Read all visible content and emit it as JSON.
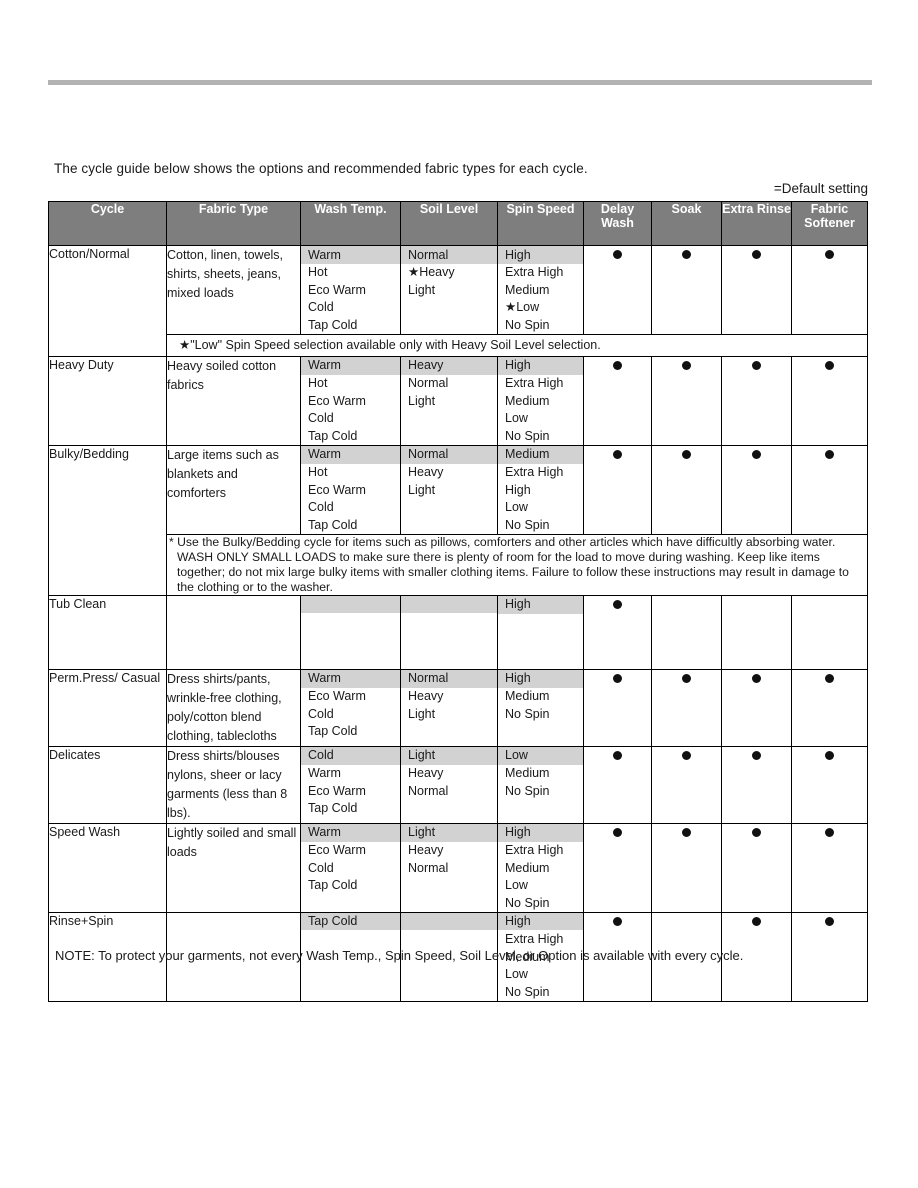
{
  "intro": {
    "text": "The cycle guide below shows the options and recommended fabric types for each cycle.",
    "default_legend": "=Default setting"
  },
  "table": {
    "headers": [
      "Cycle",
      "Fabric Type",
      "Wash Temp.",
      "Soil Level",
      "Spin Speed",
      "Delay Wash",
      "Soak",
      "Extra Rinse",
      "Fabric Softener"
    ],
    "rows": [
      {
        "cycle": "Cotton/Normal",
        "fabric": "Cotton, linen, towels, shirts, sheets, jeans, mixed loads",
        "wash_temp": [
          "Warm",
          "Hot",
          "Eco Warm",
          "Cold",
          "Tap Cold"
        ],
        "wash_temp_default": 0,
        "soil_level": [
          "Normal",
          "★Heavy",
          "Light"
        ],
        "soil_level_default": 0,
        "spin_speed": [
          "High",
          "Extra High",
          "Medium",
          "★Low",
          "No Spin"
        ],
        "spin_speed_default": 0,
        "delay_wash": true,
        "soak": true,
        "extra_rinse": true,
        "fabric_softener": true,
        "note": "★\"Low\" Spin Speed selection available only with  Heavy  Soil Level selection."
      },
      {
        "cycle": "Heavy Duty",
        "fabric": "Heavy soiled cotton fabrics",
        "wash_temp": [
          "Warm",
          "Hot",
          "Eco Warm",
          "Cold",
          "Tap Cold"
        ],
        "wash_temp_default": 0,
        "soil_level": [
          "Heavy",
          "Normal",
          "Light"
        ],
        "soil_level_default": 0,
        "spin_speed": [
          "High",
          "Extra High",
          "Medium",
          "Low",
          "No Spin"
        ],
        "spin_speed_default": 0,
        "delay_wash": true,
        "soak": true,
        "extra_rinse": true,
        "fabric_softener": true,
        "note": null
      },
      {
        "cycle": "Bulky/Bedding",
        "fabric": "Large items such as blankets and comforters",
        "wash_temp": [
          "Warm",
          "Hot",
          "Eco Warm",
          "Cold",
          "Tap Cold"
        ],
        "wash_temp_default": 0,
        "soil_level": [
          "Normal",
          "Heavy",
          "Light"
        ],
        "soil_level_default": 0,
        "spin_speed": [
          "Medium",
          "Extra High",
          "High",
          "Low",
          "No Spin"
        ],
        "spin_speed_default": 0,
        "delay_wash": true,
        "soak": true,
        "extra_rinse": true,
        "fabric_softener": true,
        "note": "* Use the Bulky/Bedding cycle for items such as pillows, comforters and other articles which have difficultly absorbing water. WASH ONLY SMALL LOADS to make sure there is plenty of room for the load to move during washing. Keep like items together; do not mix large bulky items with smaller clothing items. Failure to follow these instructions may result in damage to the clothing or to the washer."
      },
      {
        "cycle": "Tub Clean",
        "fabric": "",
        "wash_temp": [],
        "wash_temp_default": -1,
        "soil_level": [],
        "soil_level_default": -1,
        "spin_speed": [
          "High"
        ],
        "spin_speed_default": 0,
        "delay_wash": true,
        "soak": false,
        "extra_rinse": false,
        "fabric_softener": false,
        "note": null
      },
      {
        "cycle": "Perm.Press/ Casual",
        "fabric": "Dress shirts/pants, wrinkle-free clothing, poly/cotton blend clothing, tablecloths",
        "wash_temp": [
          "Warm",
          "Eco Warm",
          "Cold",
          "Tap Cold"
        ],
        "wash_temp_default": 0,
        "soil_level": [
          "Normal",
          "Heavy",
          "Light"
        ],
        "soil_level_default": 0,
        "spin_speed": [
          "High",
          "Medium",
          "No Spin"
        ],
        "spin_speed_default": 0,
        "delay_wash": true,
        "soak": true,
        "extra_rinse": true,
        "fabric_softener": true,
        "note": null
      },
      {
        "cycle": "Delicates",
        "fabric": "Dress shirts/blouses nylons, sheer or lacy garments (less than 8 lbs).",
        "wash_temp": [
          "Cold",
          "Warm",
          "Eco Warm",
          "Tap Cold"
        ],
        "wash_temp_default": 0,
        "soil_level": [
          "Light",
          "Heavy",
          "Normal"
        ],
        "soil_level_default": 0,
        "spin_speed": [
          "Low",
          "Medium",
          "No Spin"
        ],
        "spin_speed_default": 0,
        "delay_wash": true,
        "soak": true,
        "extra_rinse": true,
        "fabric_softener": true,
        "note": null
      },
      {
        "cycle": "Speed Wash",
        "fabric": "Lightly soiled and small loads",
        "wash_temp": [
          "Warm",
          "Eco Warm",
          "Cold",
          "Tap Cold"
        ],
        "wash_temp_default": 0,
        "soil_level": [
          "Light",
          "Heavy",
          "Normal"
        ],
        "soil_level_default": 0,
        "spin_speed": [
          "High",
          "Extra High",
          "Medium",
          "Low",
          "No Spin"
        ],
        "spin_speed_default": 0,
        "delay_wash": true,
        "soak": true,
        "extra_rinse": true,
        "fabric_softener": true,
        "note": null
      },
      {
        "cycle": "Rinse+Spin",
        "fabric": "",
        "wash_temp": [
          "Tap Cold"
        ],
        "wash_temp_default": 0,
        "soil_level": [],
        "soil_level_default": -1,
        "spin_speed": [
          "High",
          "Extra High",
          "Medium",
          "Low",
          "No Spin"
        ],
        "spin_speed_default": 0,
        "delay_wash": true,
        "soak": false,
        "extra_rinse": true,
        "fabric_softener": true,
        "note": null
      }
    ]
  },
  "footer": {
    "note": "NOTE: To protect your garments, not every Wash Temp., Spin Speed, Soil Level, or Option is available with every cycle."
  }
}
